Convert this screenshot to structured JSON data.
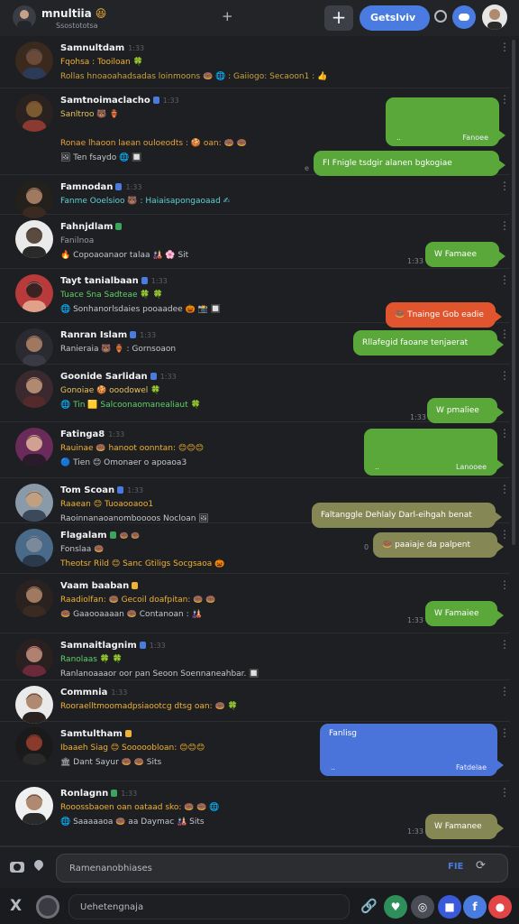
{
  "header": {
    "title": "mnultiia",
    "title_emoji": "😆",
    "subtitle": "Ssostototsa",
    "plus_label": "+",
    "pill_label": "Getslviv",
    "accent": "#4a7be0"
  },
  "rows": [
    {
      "name": "Samnultdam",
      "ts": "1:33",
      "badge": "",
      "line1": "Fqohsa : Tooiloan 🍀",
      "line1_color": "#f0b232",
      "line2": "Rollas hnoaoahadsadas loinmoons 🍩 🌐 : Gaiiogo: Secaoon1 : 👍",
      "line2_color": "#c9a23a",
      "palette": [
        "#3a2a1e",
        "#6b4a3a",
        "#2b3a57"
      ]
    },
    {
      "name": "Samtnoimaclacho",
      "ts": "1:33",
      "badge": "#4a7be0",
      "line1": "Sanltroo 🐻 🏺",
      "line1_color": "#e8c45a",
      "line2": "Ronae lhaoon laean ouloeodts : 🍪 oan: 🍩 🍩",
      "line2_color": "#e8a33a",
      "line3": "🖼 Ten fsaydo 🌐 🔲",
      "palette": [
        "#2a2220",
        "#7a5a30",
        "#8a3a30"
      ]
    },
    {
      "name": "Famnodan",
      "ts": "1:33",
      "badge": "#4a7be0",
      "line1": "Fanme Ooelsioo 🐻 : Haiaisapongaoaad ✍",
      "line1_color": "#5fd1d6",
      "line2": "",
      "palette": [
        "#24201c",
        "#a07a60",
        "#3a2a22"
      ]
    },
    {
      "name": "Fahnjdlam",
      "ts": "",
      "badge": "#3ba55d",
      "line1": "Fanilnoa",
      "line1_color": "#949ba4",
      "line2": "🔥 Copoaoanaor talaa 🎎 🌸 Sit",
      "line2_color": "#c4c7cc",
      "palette": [
        "#eaeaea",
        "#5a4a40",
        "#2a2a2a"
      ]
    },
    {
      "name": "Tayt tanialbaan",
      "ts": "1:33",
      "badge": "#4a7be0",
      "line1": "Tuace Sna Sadteae 🍀 🍀",
      "line1_color": "#5fd16a",
      "line2": "🌐 Sonhanorlsdaies pooaadee 🎃 📸 🔲",
      "line2_color": "#c4c7cc",
      "palette": [
        "#b83a3a",
        "#3a2222",
        "#e0a08a"
      ]
    },
    {
      "name": "Ranran Islam",
      "ts": "1:33",
      "badge": "#4a7be0",
      "line1": "Ranieraia 🐻 🏺 : Gornsoaon",
      "line1_color": "#c4c7cc",
      "line2": "",
      "palette": [
        "#2a2a30",
        "#a07860",
        "#3a3a44"
      ]
    },
    {
      "name": "Goonide Sarlidan",
      "ts": "1:33",
      "badge": "#4a7be0",
      "line1": "Gonoiae 🍪 ooodowel 🍀",
      "line1_color": "#e8c45a",
      "line2": "🌐 Tin 🟨 Salcoonaomanealiaut 🍀",
      "line2_color": "#5fd16a",
      "palette": [
        "#3a2a30",
        "#b08a70",
        "#552a2a"
      ]
    },
    {
      "name": "Fatinga8",
      "ts": "1:33",
      "badge": "",
      "line1": "Rauinae 🍩 hanoot oonntan: 😊😊😊",
      "line1_color": "#f0b232",
      "line2": "🔵 Tien 😊 Omonaer o apoaoa3",
      "line2_color": "#c4c7cc",
      "palette": [
        "#6a2a5a",
        "#d0a090",
        "#2a1a2a"
      ]
    },
    {
      "name": "Tom Scoan",
      "ts": "1:33",
      "badge": "#4a7be0",
      "line1": "Raaean 😊 Tuoaooaoo1",
      "line1_color": "#f0b232",
      "line2": "Raoinnanaoanomboooos Nocloan 🖼",
      "line2_color": "#c4c7cc",
      "palette": [
        "#8a9aa8",
        "#c0a080",
        "#3a4a5a"
      ]
    },
    {
      "name": "Flagalam",
      "ts": "",
      "badge": "#3ba55d",
      "badge2": "🍩 🍩",
      "line1": "Fonslaa 🍩",
      "line1_color": "#c4c7cc",
      "line2": "Theotsr Rild 😊 Sanc Gtiligs Socgsaoa 🎃",
      "line2_color": "#f0b232",
      "palette": [
        "#4a6a8a",
        "#7a8a9a",
        "#2a3a4a"
      ]
    },
    {
      "name": "Vaam baaban",
      "ts": "",
      "badge": "#f0b232",
      "line1": "Raadiolfan: 🍩 Gecoil doafpitan: 🍩 🍩",
      "line1_color": "#f0b232",
      "line2": "🍩 Gaaooaaaan 🍩 Contanoan : 🎎",
      "line2_color": "#c4c7cc",
      "palette": [
        "#2a2220",
        "#a07a60",
        "#3a2a22"
      ]
    },
    {
      "name": "Samnaitlagnim",
      "ts": "1:33",
      "badge": "#4a7be0",
      "line1": "Ranolaas 🍀 🍀",
      "line1_color": "#5fd16a",
      "line2": "Ranlanoaaaor oor pan Seoon Soennaneahbar. 🔲",
      "line2_color": "#c4c7cc",
      "palette": [
        "#2a2020",
        "#b08070",
        "#6a2a3a"
      ]
    },
    {
      "name": "Commnia",
      "ts": "1:33",
      "badge": "",
      "line1": "Rooraelltmoomadpsiaootcg dtsg oan: 🍩 🍀",
      "line1_color": "#f0b232",
      "line2": "",
      "palette": [
        "#eaeaea",
        "#b08a70",
        "#2a2220"
      ]
    },
    {
      "name": "Samtultham",
      "ts": "",
      "badge": "#f0b232",
      "line1": "Ibaaeh Siag 😊 Sooooobloan: 😊😊😊",
      "line1_color": "#f0b232",
      "line2": "🏛 Dant Sayur 🍩 🍩 Sits",
      "line2_color": "#c4c7cc",
      "palette": [
        "#1a1a1a",
        "#8a3a2a",
        "#2a2a2a"
      ]
    },
    {
      "name": "Ronlagnn",
      "ts": "1:33",
      "badge": "#3ba55d",
      "line1": "Rooossbaoen oan oataad sko: 🍩 🍩 🌐",
      "line1_color": "#f0b232",
      "line2": "🌐 Saaaaaoa 🍩 aa Daymac 🎎 Sits",
      "line2_color": "#c4c7cc",
      "palette": [
        "#f0f0f0",
        "#b08a70",
        "#2a2a2a"
      ]
    }
  ],
  "bubbles": [
    {
      "text": "",
      "stamp": "Fanoee",
      "dots": "..",
      "color": "green",
      "meta": ""
    },
    {
      "text": "FI Fnigle tsdgir alanen bgkogiae",
      "stamp": "",
      "dots": "",
      "color": "green",
      "meta": "e"
    },
    {
      "text": "W Famaee",
      "stamp": "",
      "dots": "",
      "color": "green",
      "meta": "1:33"
    },
    {
      "text": "🍩 Tnainge Gob eadie",
      "stamp": "",
      "dots": "",
      "color": "orange",
      "meta": ""
    },
    {
      "text": "Rllafegid faoane tenjaerat",
      "stamp": "",
      "dots": "",
      "color": "green",
      "meta": ""
    },
    {
      "text": "W pmaliee",
      "stamp": "",
      "dots": "",
      "color": "green",
      "meta": "1:33"
    },
    {
      "text": "",
      "stamp": "Lanooee",
      "dots": "..",
      "color": "green",
      "meta": ""
    },
    {
      "text": "Faltanggle Dehlaly Darl-eihgah benat",
      "stamp": "",
      "dots": "",
      "color": "olive",
      "meta": ""
    },
    {
      "text": "🍩 paaiaje da palpent",
      "stamp": "",
      "dots": "",
      "color": "olive",
      "meta": "0"
    },
    {
      "text": "W Famaiee",
      "stamp": "",
      "dots": "",
      "color": "green",
      "meta": "1:33"
    },
    {
      "text": "Fanlisg",
      "stamp": "Fatdelae",
      "dots": "..",
      "color": "blue",
      "meta": ""
    },
    {
      "text": "W Famanee",
      "stamp": "",
      "dots": "",
      "color": "olive",
      "meta": "1:33"
    }
  ],
  "composer": {
    "placeholder": "Ramenanobhiases",
    "chip": "FIE",
    "tool_icon": "⟳",
    "placeholder2": "Uehetengnaja",
    "x_label": "X"
  },
  "bottom_buttons": [
    {
      "name": "green-action-button",
      "color": "#2f8f5a",
      "glyph": "♥"
    },
    {
      "name": "gray-action-button",
      "color": "#4a4d55",
      "glyph": "◎"
    },
    {
      "name": "red-blue-action-button",
      "color": "#3b5ad9",
      "glyph": "■"
    },
    {
      "name": "blue-action-button",
      "color": "#4a7be0",
      "glyph": "f"
    },
    {
      "name": "red-action-button",
      "color": "#e24545",
      "glyph": "●"
    }
  ]
}
